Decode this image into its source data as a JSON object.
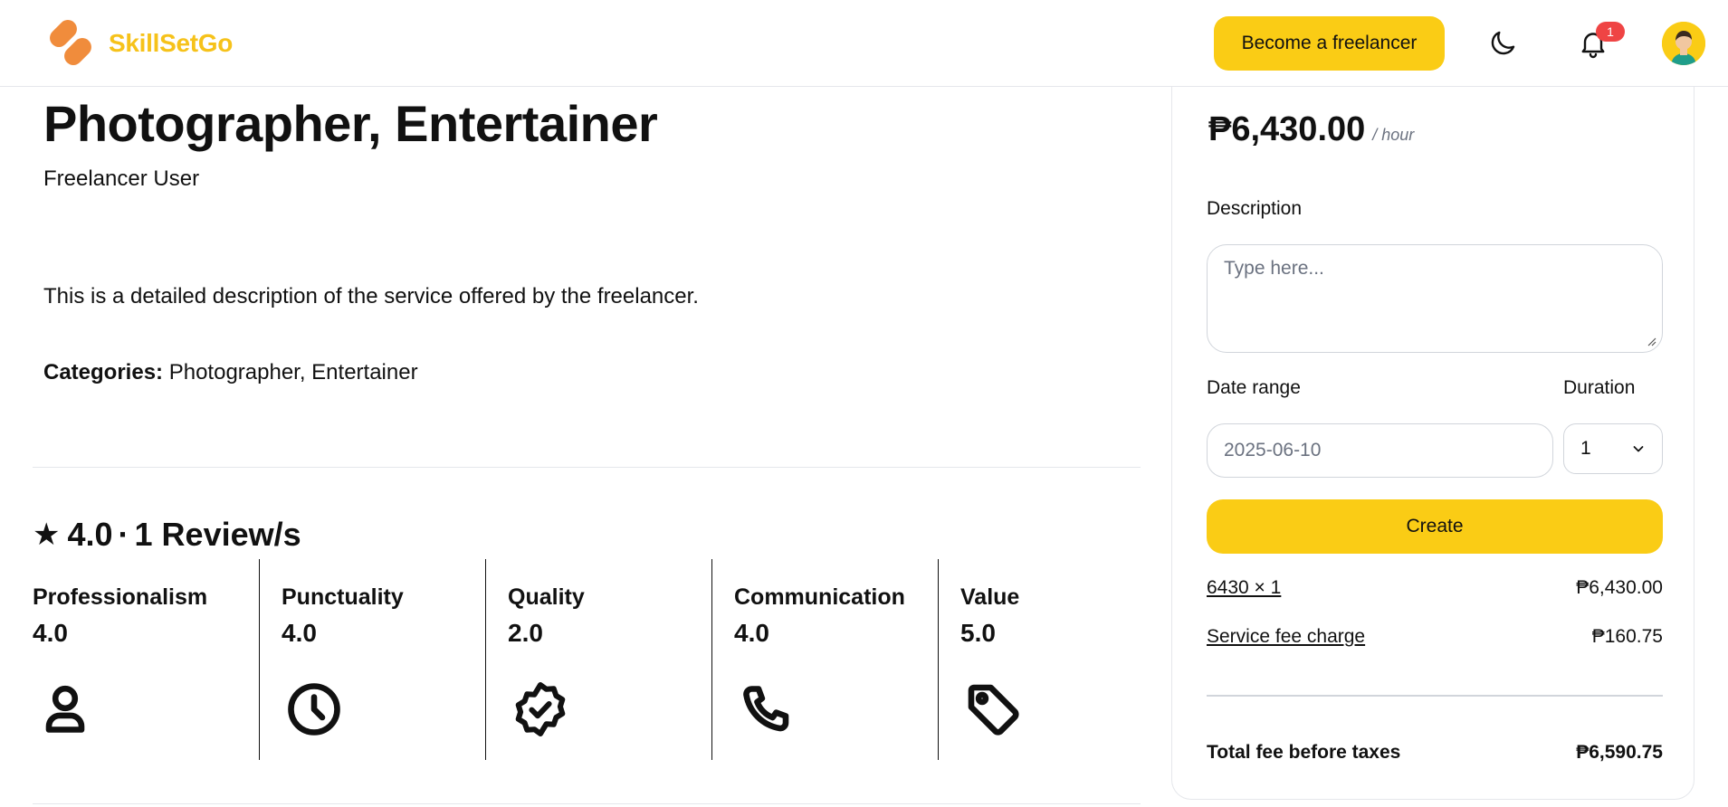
{
  "header": {
    "brand": "SkillSetGo",
    "become_freelancer": "Become a freelancer",
    "notification_count": "1",
    "icons": [
      "logo-icon",
      "moon-icon",
      "bell-icon",
      "avatar"
    ]
  },
  "service": {
    "title": "Photographer, Entertainer",
    "owner": "Freelancer User",
    "description": "This is a detailed description of the service offered by the freelancer.",
    "categories_label": "Categories:",
    "categories": "Photographer, Entertainer"
  },
  "rating": {
    "star": "★",
    "score": "4.0",
    "separator": "·",
    "reviews": "1 Review/s",
    "metrics": [
      {
        "label": "Professionalism",
        "value": "4.0",
        "icon": "person-icon"
      },
      {
        "label": "Punctuality",
        "value": "4.0",
        "icon": "clock-icon"
      },
      {
        "label": "Quality",
        "value": "2.0",
        "icon": "verified-badge-icon"
      },
      {
        "label": "Communication",
        "value": "4.0",
        "icon": "phone-icon"
      },
      {
        "label": "Value",
        "value": "5.0",
        "icon": "tag-icon"
      }
    ]
  },
  "booking": {
    "price": "₱6,430.00",
    "per_unit": "/ hour",
    "description_label": "Description",
    "description_placeholder": "Type here...",
    "date_range_label": "Date range",
    "date_value": "2025-06-10",
    "duration_label": "Duration",
    "duration_value": "1",
    "create_label": "Create",
    "line_calc": "6430 × 1",
    "line_calc_amount": "₱6,430.00",
    "service_fee_label": "Service fee charge",
    "service_fee_amount": "₱160.75",
    "total_label": "Total fee before taxes",
    "total_amount": "₱6,590.75"
  },
  "colors": {
    "accent": "#facc15",
    "brand_text": "#f6c21a",
    "logo": "#f08c3c",
    "badge": "#ef4444"
  }
}
